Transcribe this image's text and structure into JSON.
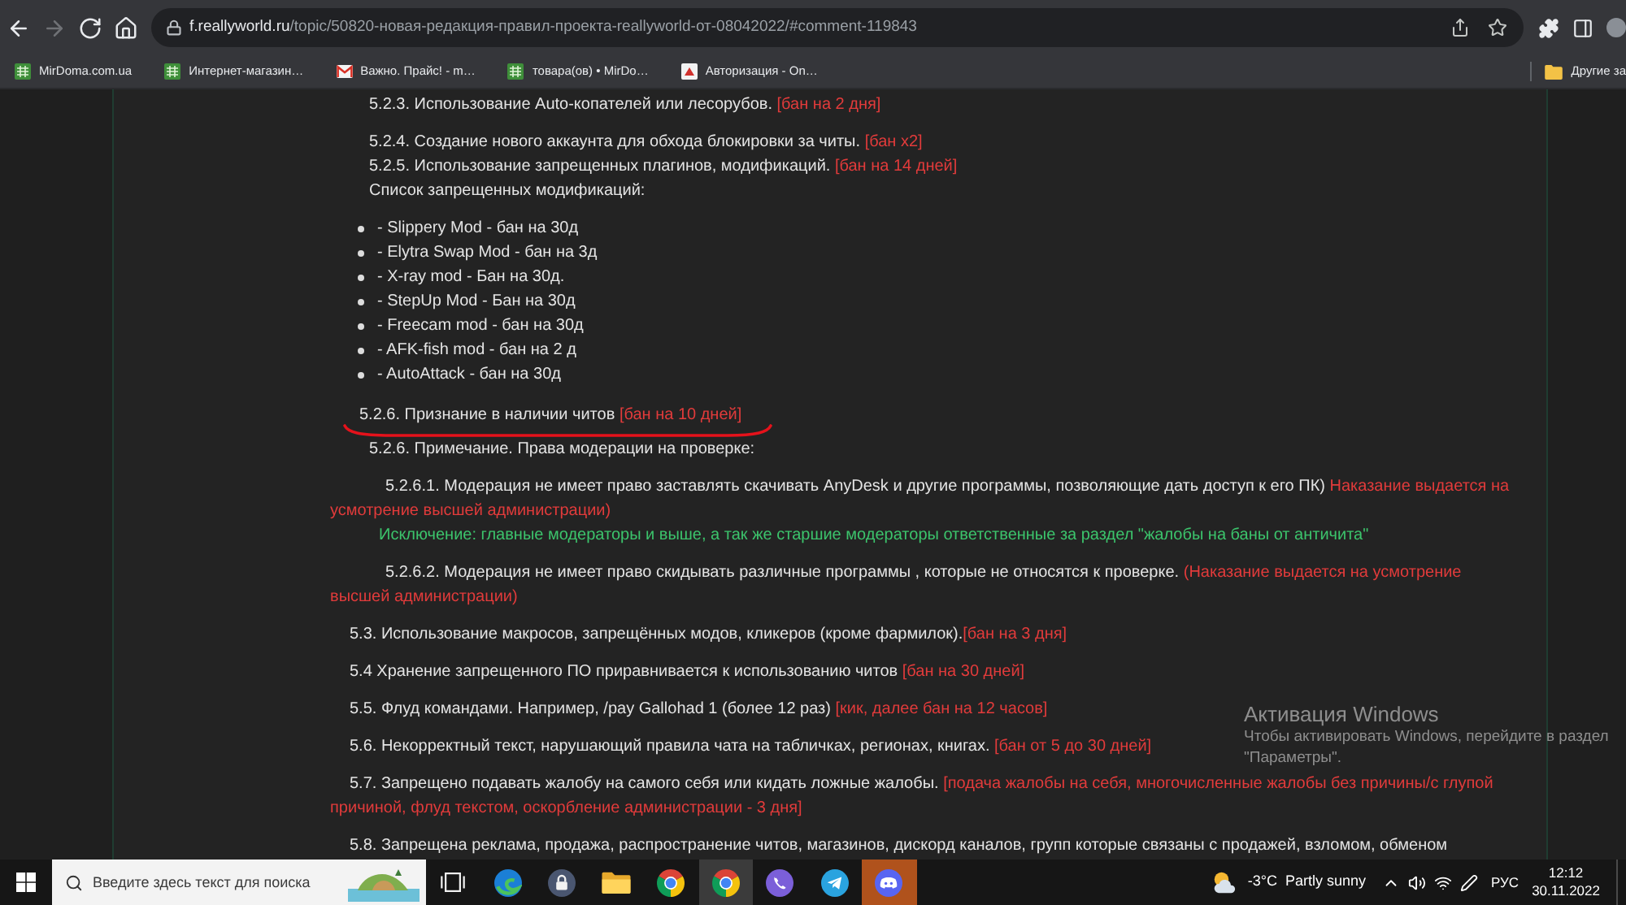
{
  "browser": {
    "nav_buttons": [
      {
        "kind": "back",
        "disabled": false
      },
      {
        "kind": "forward",
        "disabled": true
      },
      {
        "kind": "reload",
        "disabled": false
      },
      {
        "kind": "home",
        "disabled": false
      }
    ],
    "address": {
      "host": "f.reallyworld.ru",
      "path": "/topic/50820-новая-редакция-правил-проекта-reallyworld-от-08042022/#comment-119843",
      "starred": false
    },
    "bookmarks": [
      {
        "label": "MirDoma.com.ua",
        "kind": "shop"
      },
      {
        "label": "Интернет-магазин…",
        "kind": "shop"
      },
      {
        "label": "Важно. Прайс! - m…",
        "kind": "mail"
      },
      {
        "label": "товара(ов) • MirDo…",
        "kind": "shop"
      },
      {
        "label": "Авторизация - On…",
        "kind": "page"
      }
    ],
    "other_bookmarks": "Другие за"
  },
  "content": [
    {
      "kind": "paragraphs",
      "items": [
        {
          "kind": "item",
          "text": "5.2.3. Использование Auto-копателей или лесорубов.",
          "penalty": "[бан на 2 дня]",
          "attached": false
        }
      ]
    },
    {
      "kind": "paragraphs",
      "items": [
        {
          "kind": "item",
          "text": "5.2.4. Создание нового аккаунта для обхода блокировки за читы.",
          "penalty": "[бан x2]",
          "attached": false
        },
        {
          "kind": "item",
          "text": "5.2.5. Использование запрещенных плагинов, модификаций.",
          "penalty": "[бан на 14 дней]",
          "attached": false
        },
        {
          "kind": "heading",
          "text": "Список запрещенных модификаций:"
        }
      ]
    },
    {
      "kind": "list",
      "items": [
        "- Slippery Mod - бан на 30д",
        "- Elytra Swap Mod - бан на 3д",
        "- X-ray mod - Бан на 30д.",
        "- StepUp Mod - Бан на 30д",
        "- Freecam mod - бан на 30д",
        "- AFK-fish mod - бан на 2 д",
        "- AutoAttack - бан на 30д"
      ]
    },
    {
      "kind": "paragraphs",
      "items": [
        {
          "kind": "marked",
          "text": "5.2.6. Признание в наличии читов",
          "penalty": "[бан на 10 дней]",
          "attached": false
        }
      ]
    },
    {
      "kind": "paragraphs",
      "items": [
        {
          "kind": "item",
          "text": "5.2.6. Примечание. Права модерации на проверке:"
        }
      ]
    },
    {
      "kind": "paragraphs",
      "items": [
        {
          "kind": "subitem",
          "text": "5.2.6.1. Модерация не имеет право заставлять скачивать AnyDesk и другие программы, позволяющие дать доступ к его ПК)",
          "penalty": "Наказание выдается на усмотрение высшей администрации)",
          "attached": false
        },
        {
          "kind": "exception",
          "text": "Исключение: главные модераторы и выше, а так же старшие модераторы ответственные за раздел \"жалобы на баны от античита\""
        }
      ]
    },
    {
      "kind": "paragraphs",
      "items": [
        {
          "kind": "subitem",
          "text": "5.2.6.2. Модерация не имеет право скидывать различные программы , которые не относятся к проверке.",
          "penalty": "(Наказание выдается на усмотрение высшей администрации)",
          "attached": false
        }
      ]
    },
    {
      "kind": "paragraphs",
      "items": [
        {
          "kind": "rule",
          "text": "5.3. Использование макросов, запрещённых модов, кликеров (кроме фармилок).",
          "penalty": "[бан на 3 дня]",
          "attached": true
        }
      ]
    },
    {
      "kind": "paragraphs",
      "items": [
        {
          "kind": "rule",
          "text": "5.4 Хранение запрещенного ПО приравнивается к использованию читов",
          "penalty": "[бан на 30 дней]",
          "attached": false
        }
      ]
    },
    {
      "kind": "paragraphs",
      "items": [
        {
          "kind": "rule",
          "text": "5.5. Флуд командами. Например, /pay Gallohad 1 (более 12 раз)",
          "penalty": "[кик, далее бан на 12 часов]",
          "attached": false
        }
      ]
    },
    {
      "kind": "paragraphs",
      "items": [
        {
          "kind": "rule",
          "text": "5.6. Некорректный текст, нарушающий правила чата на табличках, регионах, книгах.",
          "penalty": "[бан от 5 до 30 дней]",
          "attached": false
        }
      ]
    },
    {
      "kind": "paragraphs",
      "items": [
        {
          "kind": "rule",
          "text": "5.7. Запрещено подавать жалобу на самого себя или кидать ложные жалобы.",
          "penalty": "[подача жалобы на себя, многочисленные жалобы без причины/с глупой причиной, флуд текстом, оскорбление администрации - 3 дня]",
          "attached": false
        }
      ]
    },
    {
      "kind": "paragraphs",
      "items": [
        {
          "kind": "rule",
          "text": "5.8. Запрещена реклама, продажа, распространение читов, магазинов, дискорд каналов, групп которые связаны с продажей, взломом, обменом"
        }
      ]
    }
  ],
  "watermark": {
    "title": "Активация Windows",
    "text": "Чтобы активировать Windows, перейдите в раздел \"Параметры\"."
  },
  "taskbar": {
    "search": {
      "placeholder": "Введите здесь текст для поиска"
    },
    "apps": [
      {
        "kind": "task_view",
        "active": false,
        "attention": false
      },
      {
        "kind": "edge",
        "active": false,
        "attention": false
      },
      {
        "kind": "lock",
        "active": false,
        "attention": false
      },
      {
        "kind": "folder",
        "active": false,
        "attention": false
      },
      {
        "kind": "chrome",
        "active": false,
        "attention": false
      },
      {
        "kind": "chrome",
        "active": true,
        "attention": false
      },
      {
        "kind": "viber",
        "active": false,
        "attention": false
      },
      {
        "kind": "telegram",
        "active": false,
        "attention": false
      },
      {
        "kind": "discord",
        "active": false,
        "attention": true
      }
    ],
    "weather": {
      "temperature": "-3°C",
      "condition": "Partly sunny"
    },
    "language": "РУС",
    "time": "12:12",
    "date": "30.11.2022"
  }
}
